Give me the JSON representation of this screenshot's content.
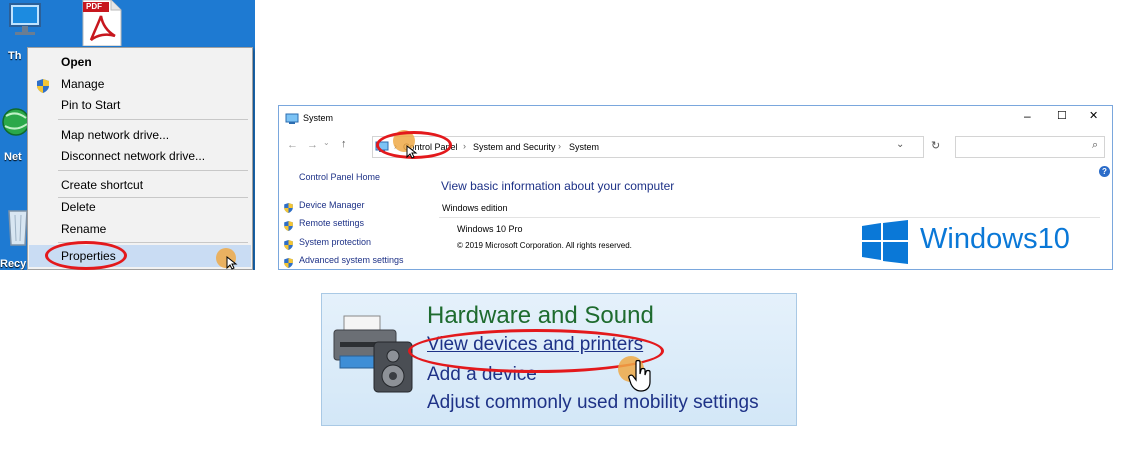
{
  "desktop": {
    "icon_labels": [
      "Th",
      "Net",
      "Recy"
    ],
    "pdf_badge": "PDF",
    "context_menu": {
      "items": [
        "Open",
        "Manage",
        "Pin to Start",
        "Map network drive...",
        "Disconnect network drive...",
        "Create shortcut",
        "Delete",
        "Rename",
        "Properties"
      ]
    }
  },
  "system_window": {
    "title": "System",
    "breadcrumb": [
      "Control Panel",
      "System and Security",
      "System"
    ],
    "breadcrumb_sep": "›",
    "left_nav": {
      "home": "Control Panel Home",
      "links": [
        "Device Manager",
        "Remote settings",
        "System protection",
        "Advanced system settings"
      ]
    },
    "heading": "View basic information about your computer",
    "edition_label": "Windows edition",
    "edition": "Windows 10 Pro",
    "copyright": "© 2019 Microsoft Corporation. All rights reserved.",
    "logo_text": "Windows10",
    "controls": {
      "minimize": "–",
      "maximize": "☐",
      "close": "✕"
    },
    "dropdown_glyph": "⌄",
    "refresh_glyph": "↻",
    "search_glyph": "⌕",
    "help_glyph": "?"
  },
  "hardware_sound": {
    "title": "Hardware and Sound",
    "links": [
      "View devices and printers",
      "Add a device",
      "Adjust commonly used mobility settings"
    ]
  },
  "colors": {
    "desktop_bg": "#1e7ad2",
    "highlight_ring": "#e3191c",
    "cursor_dot": "#efa946",
    "link_blue": "#1e3287",
    "windows_logo": "#0a78d7",
    "hw_title_green": "#1e6b2e"
  }
}
